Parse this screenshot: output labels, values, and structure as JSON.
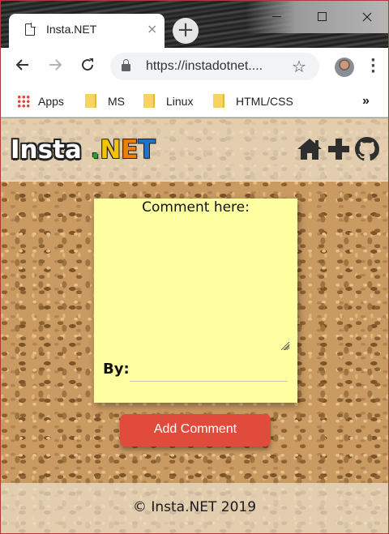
{
  "browser": {
    "tab_title": "Insta.NET",
    "tab_close": "×",
    "new_tab": "+",
    "url": "https://instadotnet....",
    "bookmarks": [
      {
        "label": "Apps",
        "icon": "apps-grid-icon"
      },
      {
        "label": "MS",
        "icon": "folder-icon"
      },
      {
        "label": "Linux",
        "icon": "folder-icon"
      },
      {
        "label": "HTML/CSS",
        "icon": "folder-icon"
      }
    ],
    "bookmarks_overflow": "»"
  },
  "header": {
    "logo_insta": "Insta",
    "logo_dot": ".",
    "logo_n": "N",
    "logo_e": "E",
    "logo_t": "T",
    "icons": [
      "home-icon",
      "plus-icon",
      "github-icon"
    ]
  },
  "form": {
    "comment_label": "Comment here:",
    "comment_value": "",
    "by_label": "By:",
    "by_value": "",
    "submit_label": "Add Comment"
  },
  "footer": {
    "text": "© Insta.NET 2019"
  },
  "colors": {
    "note_background": "#feffa0",
    "button_red": "#e14b3c",
    "cork": "#c99a62"
  }
}
